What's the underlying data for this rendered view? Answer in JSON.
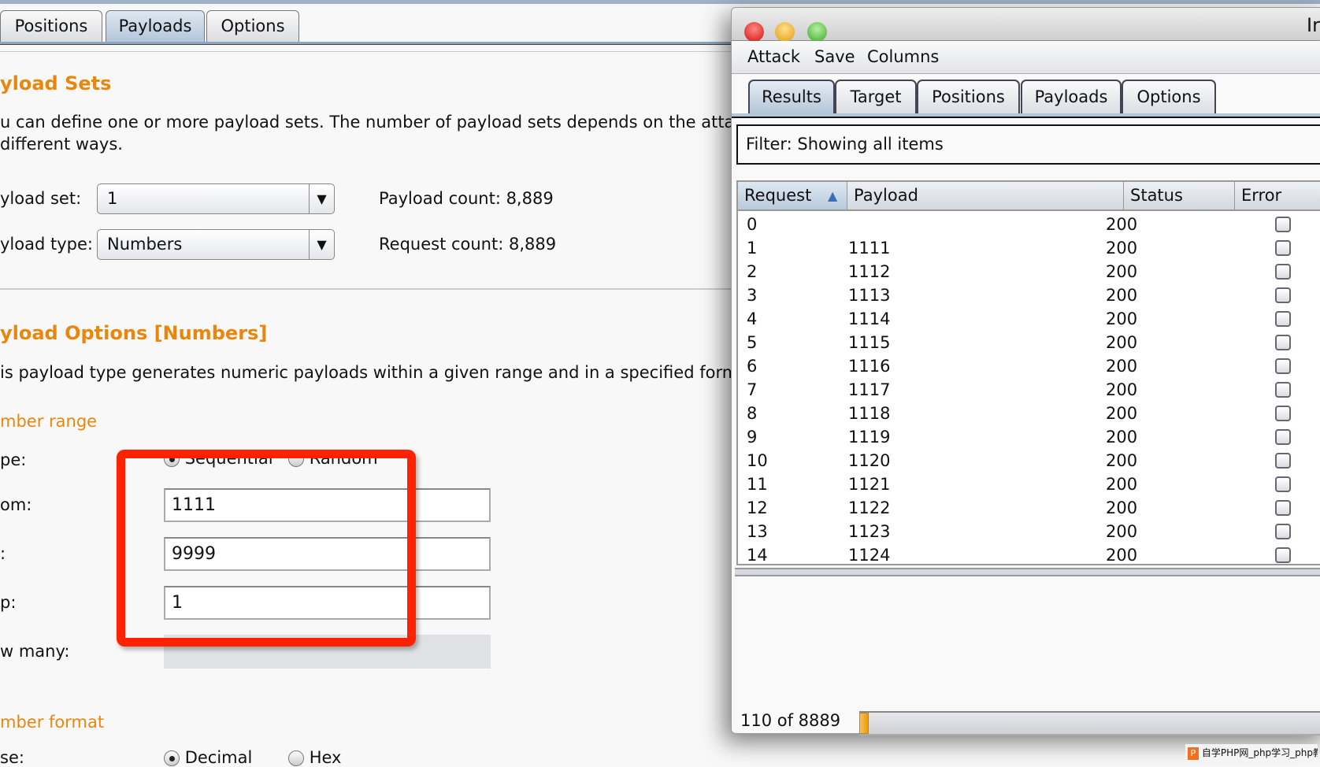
{
  "main_tabs": [
    {
      "label": "Positions"
    },
    {
      "label": "Payloads",
      "active": true
    },
    {
      "label": "Options"
    }
  ],
  "payload_sets": {
    "heading": "yload Sets",
    "description_1": "u can define one or more payload sets. The number of payload sets depends on the atta",
    "description_2": "different ways.",
    "set_label": "yload set:",
    "set_value": "1",
    "type_label": "yload type:",
    "type_value": "Numbers",
    "payload_count": "Payload count:  8,889",
    "request_count": "Request count:  8,889"
  },
  "payload_options": {
    "heading": "yload Options [Numbers]",
    "description": "is payload type generates numeric payloads within a given range and in a specified form",
    "number_range": "mber range",
    "type_label": "pe:",
    "sequential": "Sequential",
    "random": "Random",
    "sequential_selected": true,
    "from_label": "om:",
    "from_value": "1111",
    "to_label": ":",
    "to_value": "9999",
    "step_label": "p:",
    "step_value": "1",
    "how_many_label": "w many:",
    "number_format": "mber format",
    "base_label": "se:",
    "decimal": "Decimal",
    "hex": "Hex",
    "decimal_selected": true
  },
  "highlight_color": "#ff2200",
  "attack_window": {
    "title": "Ir",
    "menu": [
      "Attack",
      "Save",
      "Columns"
    ],
    "tabs": [
      {
        "label": "Results",
        "active": true
      },
      {
        "label": "Target"
      },
      {
        "label": "Positions"
      },
      {
        "label": "Payloads"
      },
      {
        "label": "Options"
      }
    ],
    "filter": "Filter:  Showing all items",
    "columns": [
      "Request",
      "Payload",
      "Status",
      "Error"
    ],
    "sort_icon": "sort-ascending-icon",
    "rows": [
      {
        "request": "0",
        "payload": "",
        "status": "200"
      },
      {
        "request": "1",
        "payload": "1111",
        "status": "200"
      },
      {
        "request": "2",
        "payload": "1112",
        "status": "200"
      },
      {
        "request": "3",
        "payload": "1113",
        "status": "200"
      },
      {
        "request": "4",
        "payload": "1114",
        "status": "200"
      },
      {
        "request": "5",
        "payload": "1115",
        "status": "200"
      },
      {
        "request": "6",
        "payload": "1116",
        "status": "200"
      },
      {
        "request": "7",
        "payload": "1117",
        "status": "200"
      },
      {
        "request": "8",
        "payload": "1118",
        "status": "200"
      },
      {
        "request": "9",
        "payload": "1119",
        "status": "200"
      },
      {
        "request": "10",
        "payload": "1120",
        "status": "200"
      },
      {
        "request": "11",
        "payload": "1121",
        "status": "200"
      },
      {
        "request": "12",
        "payload": "1122",
        "status": "200"
      },
      {
        "request": "13",
        "payload": "1123",
        "status": "200"
      },
      {
        "request": "14",
        "payload": "1124",
        "status": "200"
      }
    ],
    "progress_text": "110 of 8889",
    "progress_fraction": 0.0124,
    "progress_color": "#f0a010"
  },
  "watermark": "自学PHP网_php学习_php教"
}
